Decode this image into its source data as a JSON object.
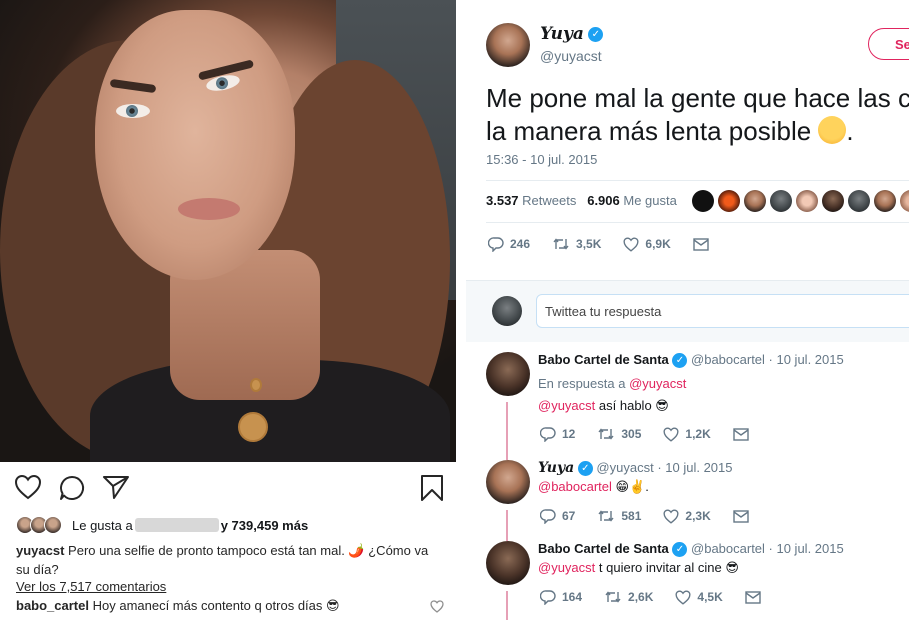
{
  "instagram": {
    "likes_prefix": "Le gusta a",
    "likes_suffix": "y 739,459 más",
    "caption_user": "yuyacst",
    "caption_text": "Pero una selfie de pronto tampoco está tan mal. 🌶️ ¿Cómo va su día?",
    "view_comments": "Ver los 7,517 comentarios",
    "comment_user": "babo_cartel",
    "comment_text": "Hoy amanecí más contento q otros días 😎"
  },
  "tweet": {
    "name": "Yuya",
    "handle": "@yuyacst",
    "follow_label": "Se",
    "text_line1": "Me pone mal la gente que hace las co",
    "text_line2": "la manera más lenta posible",
    "text_line2_end": ".",
    "timestamp": "15:36 - 10 jul. 2015",
    "retweets_count": "3.537",
    "retweets_label": "Retweets",
    "likes_count": "6.906",
    "likes_label": "Me gusta",
    "actions": {
      "reply": "246",
      "retweet": "3,5K",
      "like": "6,9K"
    }
  },
  "reply_box": {
    "placeholder": "Twittea tu respuesta"
  },
  "replies": [
    {
      "name": "Babo Cartel de Santa",
      "handle": "@babocartel",
      "date": "· 10 jul. 2015",
      "in_reply_prefix": "En respuesta a",
      "in_reply_handle": "@yuyacst",
      "mention": "@yuyacst",
      "text": "así hablo 😎",
      "actions": {
        "reply": "12",
        "retweet": "305",
        "like": "1,2K"
      }
    },
    {
      "name": "Yuya",
      "handle": "@yuyacst",
      "date": "· 10 jul. 2015",
      "mention": "@babocartel",
      "text": "😁✌️.",
      "actions": {
        "reply": "67",
        "retweet": "581",
        "like": "2,3K"
      }
    },
    {
      "name": "Babo Cartel de Santa",
      "handle": "@babocartel",
      "date": "· 10 jul. 2015",
      "mention": "@yuyacst",
      "text": "t quiero invitar al cine 😎",
      "actions": {
        "reply": "164",
        "retweet": "2,6K",
        "like": "4,5K"
      }
    }
  ],
  "colors": {
    "twitter_blue": "#1da1f2",
    "mention_pink": "#e0245e",
    "muted": "#657786"
  }
}
